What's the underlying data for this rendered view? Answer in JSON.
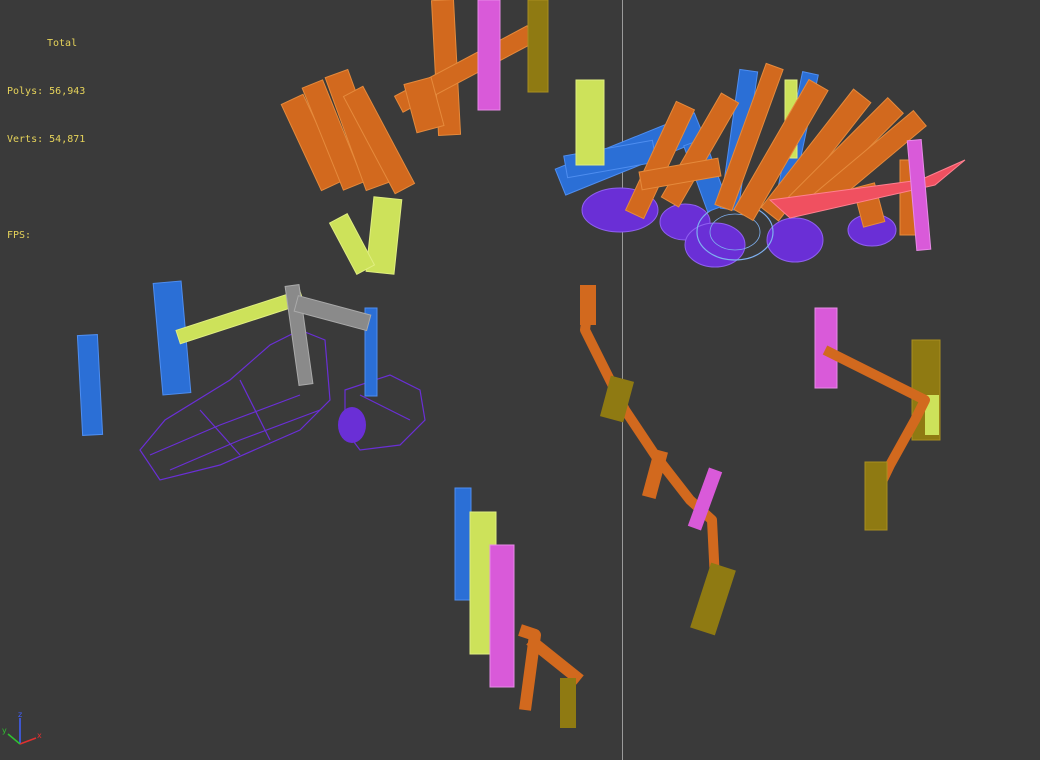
{
  "viewport": {
    "background": "#3a3a3a",
    "divider_color": "#9a9a9a"
  },
  "stats": {
    "title": "Total",
    "polys_label": "Polys:",
    "polys_value": "56,943",
    "verts_label": "Verts:",
    "verts_value": "54,871",
    "fps_label": "FPS:",
    "fps_value": "",
    "color": "#e6d35a"
  },
  "gizmo": {
    "axes": [
      "x",
      "y",
      "z"
    ],
    "x_color": "#e03030",
    "y_color": "#30c030",
    "z_color": "#4060ff"
  },
  "wire_colors": {
    "orange": "#d2691e",
    "olive": "#8f7a12",
    "pink": "#d95ad9",
    "lime": "#cde25a",
    "blue": "#2b6fd6",
    "purple": "#6a2fd6",
    "red": "#f05060",
    "gray": "#8a8a8a",
    "lightblue": "#7fb0f0"
  }
}
